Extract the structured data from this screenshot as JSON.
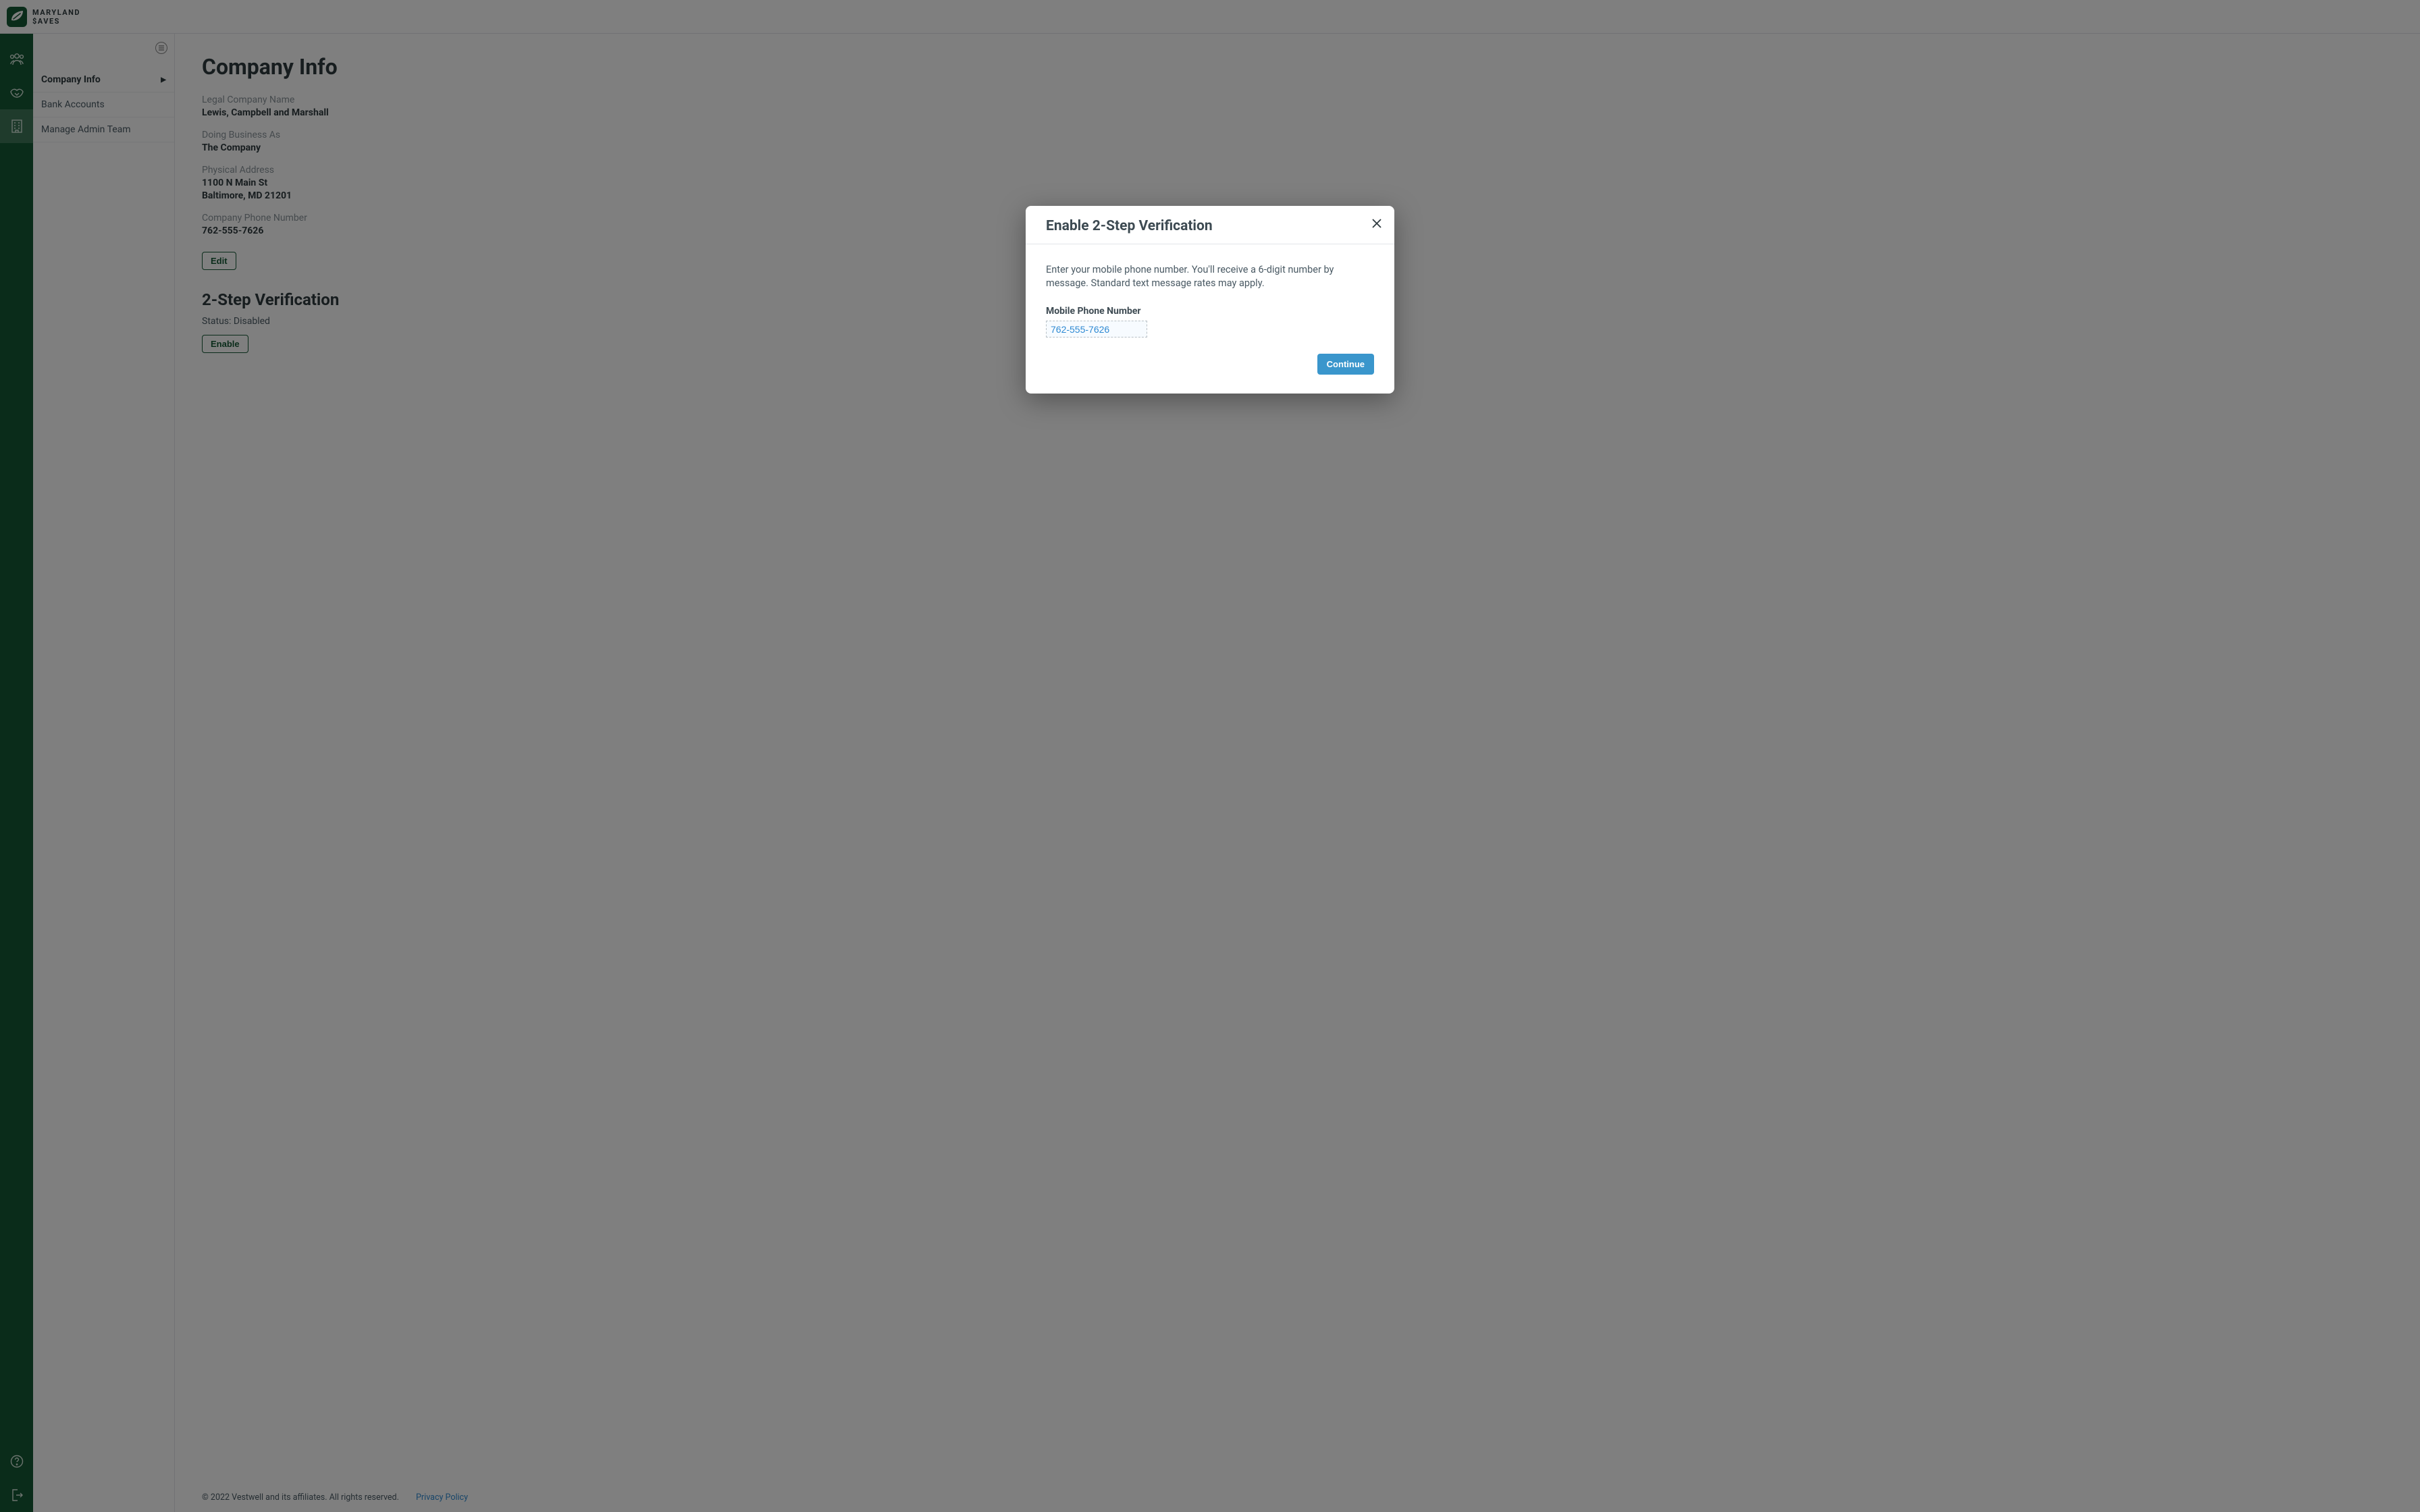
{
  "brand": {
    "line1": "MARYLAND",
    "line2": "$AVES"
  },
  "sidebar": {
    "items": [
      {
        "label": "Company Info"
      },
      {
        "label": "Bank Accounts"
      },
      {
        "label": "Manage Admin Team"
      }
    ]
  },
  "page": {
    "title": "Company Info",
    "legal_label": "Legal Company Name",
    "legal_value": "Lewis, Campbell and Marshall",
    "dba_label": "Doing Business As",
    "dba_value": "The Company",
    "address_label": "Physical Address",
    "address_line1": "1100 N Main St",
    "address_line2": "Baltimore, MD 21201",
    "phone_label": "Company Phone Number",
    "phone_value": "762-555-7626",
    "edit_btn": "Edit",
    "twostep_title": "2-Step Verification",
    "twostep_status": "Status: Disabled",
    "enable_btn": "Enable"
  },
  "footer": {
    "copyright": "© 2022 Vestwell and its affiliates. All rights reserved.",
    "privacy": "Privacy Policy"
  },
  "modal": {
    "title": "Enable 2-Step Verification",
    "body_text": "Enter your mobile phone number. You'll receive a 6-digit number by message. Standard text message rates may apply.",
    "input_label": "Mobile Phone Number",
    "input_value": "762-555-7626",
    "continue_btn": "Continue"
  }
}
